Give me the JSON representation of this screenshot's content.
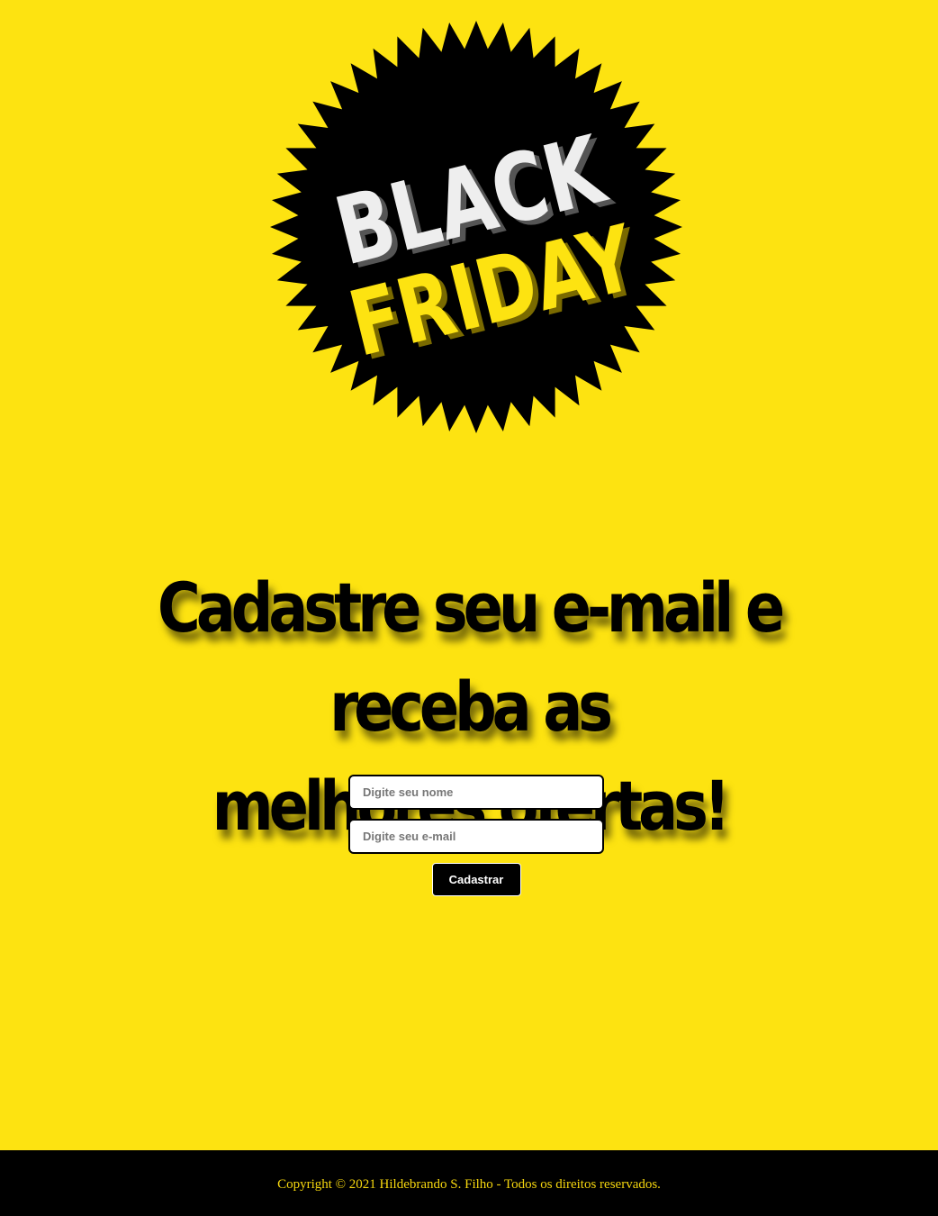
{
  "colors": {
    "background": "#fde311",
    "footer_background": "#000000",
    "footer_text": "#f5d60e",
    "badge": "#000000",
    "badge_text_top": "#eeeeee",
    "badge_text_bottom": "#fde311"
  },
  "logo": {
    "line1": "BLACK",
    "line2": "FRIDAY"
  },
  "headline": {
    "line1": "Cadastre seu e-mail e receba as",
    "line2": "melhores ofertas!"
  },
  "form": {
    "name_placeholder": "Digite seu nome",
    "email_placeholder": "Digite seu e-mail",
    "submit_label": "Cadastrar"
  },
  "footer": {
    "copyright": "Copyright © 2021 Hildebrando S. Filho - Todos os direitos reservados."
  }
}
